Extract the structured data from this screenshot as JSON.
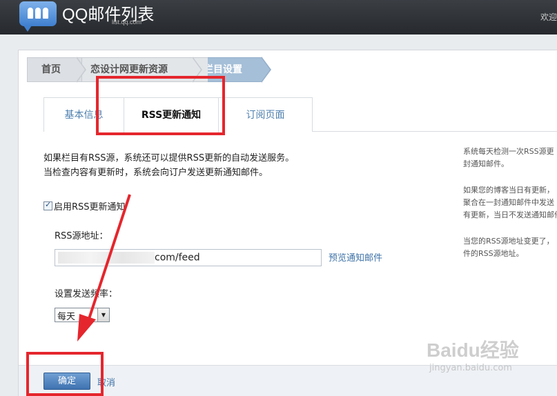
{
  "header": {
    "title": "QQ邮件列表",
    "subtitle": "list.qq.com",
    "welcome": "欢迎"
  },
  "breadcrumb": [
    "首页",
    "恋设计网更新资源",
    "栏目设置"
  ],
  "tabs": [
    "基本信息",
    "RSS更新通知",
    "订阅页面"
  ],
  "content": {
    "desc_line1": "如果栏目有RSS源，系统还可以提供RSS更新的自动发送服务。",
    "desc_line2": "当检查内容有更新时，系统会向订户发送更新通知邮件。",
    "enable_label": "启用RSS更新通知",
    "rss_label": "RSS源地址：",
    "rss_value": "com/feed",
    "preview_link": "预览通知邮件",
    "freq_label": "设置发送频率：",
    "freq_value": "每天"
  },
  "hints": {
    "h1_line1": "系统每天检测一次RSS源更",
    "h1_line2": "封通知邮件。",
    "h2_line1": "如果您的博客当日有更新，",
    "h2_line2": "聚合在一封通知邮件中发送",
    "h2_line3": "有更新，当日不发送通知邮件",
    "h3_line1": "当您的RSS源地址变更了，",
    "h3_line2": "件的RSS源地址。"
  },
  "footer": {
    "ok": "确定",
    "cancel": "取消"
  },
  "watermark": {
    "main": "Baidu经验",
    "sub": "jingyan.baidu.com"
  },
  "colors": {
    "annotation": "#e5262d",
    "link": "#3f73a8",
    "header_bg": "#2f3337"
  },
  "icons": {
    "logo": "qq-mail-list-logo",
    "checkbox": "checkmark",
    "dropdown": "triangle-down"
  }
}
